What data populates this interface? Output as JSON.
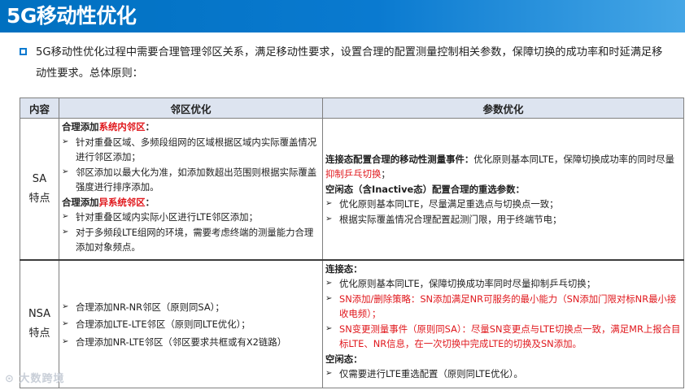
{
  "header": {
    "title": "5G移动性优化"
  },
  "intro": {
    "text": "5G移动性优化过程中需要合理管理邻区关系，满足移动性要求，设置合理的配置测量控制相关参数，保障切换的成功率和时延满足移动性要求。总体原则："
  },
  "table": {
    "headers": [
      "内容",
      "邻区优化",
      "参数优化"
    ],
    "sa": {
      "label1": "SA",
      "label2": "特点",
      "neighbor": {
        "h1_prefix": "合理添加",
        "h1_red": "系统内邻区",
        "h1_suffix": "：",
        "items1": [
          "针对重叠区域、多频段组网的区域根据区域内实际覆盖情况进行邻区添加；",
          "邻区添加以最大化为准，如添加数超出范围则根据实际覆盖强度进行排序添加。"
        ],
        "h2_prefix": "合理添加",
        "h2_red": "异系统邻区",
        "h2_suffix": "：",
        "items2": [
          "针对重叠区域内实际小区进行LTE邻区添加；",
          "对于多频段LTE组网的环境，需要考虑终端的测量能力合理添加对象频点。"
        ]
      },
      "param": {
        "p1_bold": "连接态配置合理的移动性测量事件：",
        "p1_text": "优化原则基本同LTE，保障切换成功率的同时尽量",
        "p1_red": "抑制乒乓切换",
        "p1_end": "；",
        "p2_bold": "空闲态（含Inactive态）配置合理的重选参数：",
        "items": [
          "优化原则基本同LTE，尽量满足重选点与切换点一致；",
          "根据实际覆盖情况合理配置起测门限，用于终端节电；"
        ]
      }
    },
    "nsa": {
      "label1": "NSA",
      "label2": "特点",
      "neighbor_items": [
        "合理添加NR-NR邻区（原则同SA）；",
        "合理添加LTE-LTE邻区（原则同LTE优化）；",
        "合理添加NR-LTE邻区（邻区要求共框或有X2链路）"
      ],
      "param": {
        "h1": "连接态：",
        "item1": "优化原则基本同LTE，保障切换成功率同时尽量抑制乒乓切换；",
        "item2": "SN添加/删除策略：SN添加满足NR可服务的最小能力（SN添加门限对标NR最小接收电频）；",
        "item3": "SN变更测量事件（原则同SA）：尽量SN变更点与LTE切换点一致，满足MR上报合目标LTE、NR信息，在一次切换中完成LTE的切换及SN添加。",
        "h2": "空闲态：",
        "item4": "仅需要进行LTE重选配置（原则同LTE优化）。"
      }
    }
  },
  "watermark": "大数跨境",
  "colors": {
    "title_bg": "#0070c0",
    "accent_red": "#e0181d",
    "header_bg": "#dde4f0"
  }
}
